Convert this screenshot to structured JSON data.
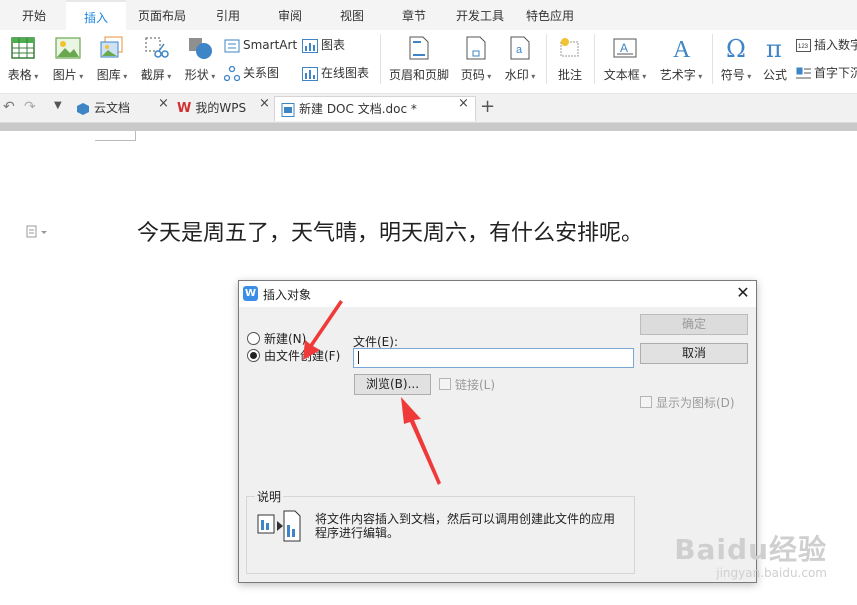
{
  "ribbon_tabs": [
    "开始",
    "插入",
    "页面布局",
    "引用",
    "审阅",
    "视图",
    "章节",
    "开发工具",
    "特色应用"
  ],
  "active_tab": "插入",
  "ribbon": {
    "table": "表格",
    "picture": "图片",
    "gallery": "图库",
    "screenshot": "截屏",
    "shapes": "形状",
    "smartart": "SmartArt",
    "relation": "关系图",
    "chart": "图表",
    "online_chart": "在线图表",
    "header_footer": "页眉和页脚",
    "page_number": "页码",
    "watermark": "水印",
    "comment": "批注",
    "textbox": "文本框",
    "wordart": "艺术字",
    "symbol": "符号",
    "formula": "公式",
    "insert_number": "插入数字",
    "drop_cap": "首字下沉"
  },
  "doc_tabs": [
    {
      "label": "云文档"
    },
    {
      "label": "我的WPS"
    },
    {
      "label": "新建 DOC 文档.doc *"
    }
  ],
  "document_text": "今天是周五了，天气晴，明天周六，有什么安排呢。",
  "dialog": {
    "title": "插入对象",
    "radio_new": "新建(N)",
    "radio_from_file": "由文件创建(F)",
    "selected_option": "由文件创建(F)",
    "file_label": "文件(E):",
    "file_value": "",
    "browse": "浏览(B)...",
    "link": "链接(L)",
    "ok": "确定",
    "cancel": "取消",
    "display_as_icon": "显示为图标(D)",
    "desc_title": "说明",
    "desc_text_line1": "将文件内容插入到文档，然后可以调用创建此文件的应用",
    "desc_text_line2": "程序进行编辑。"
  },
  "watermark": {
    "brand": "Baidu经验",
    "url": "jingyan.baidu.com"
  },
  "colors": {
    "accent": "#1e88e5",
    "annotation_arrow": "#f03a3a"
  }
}
